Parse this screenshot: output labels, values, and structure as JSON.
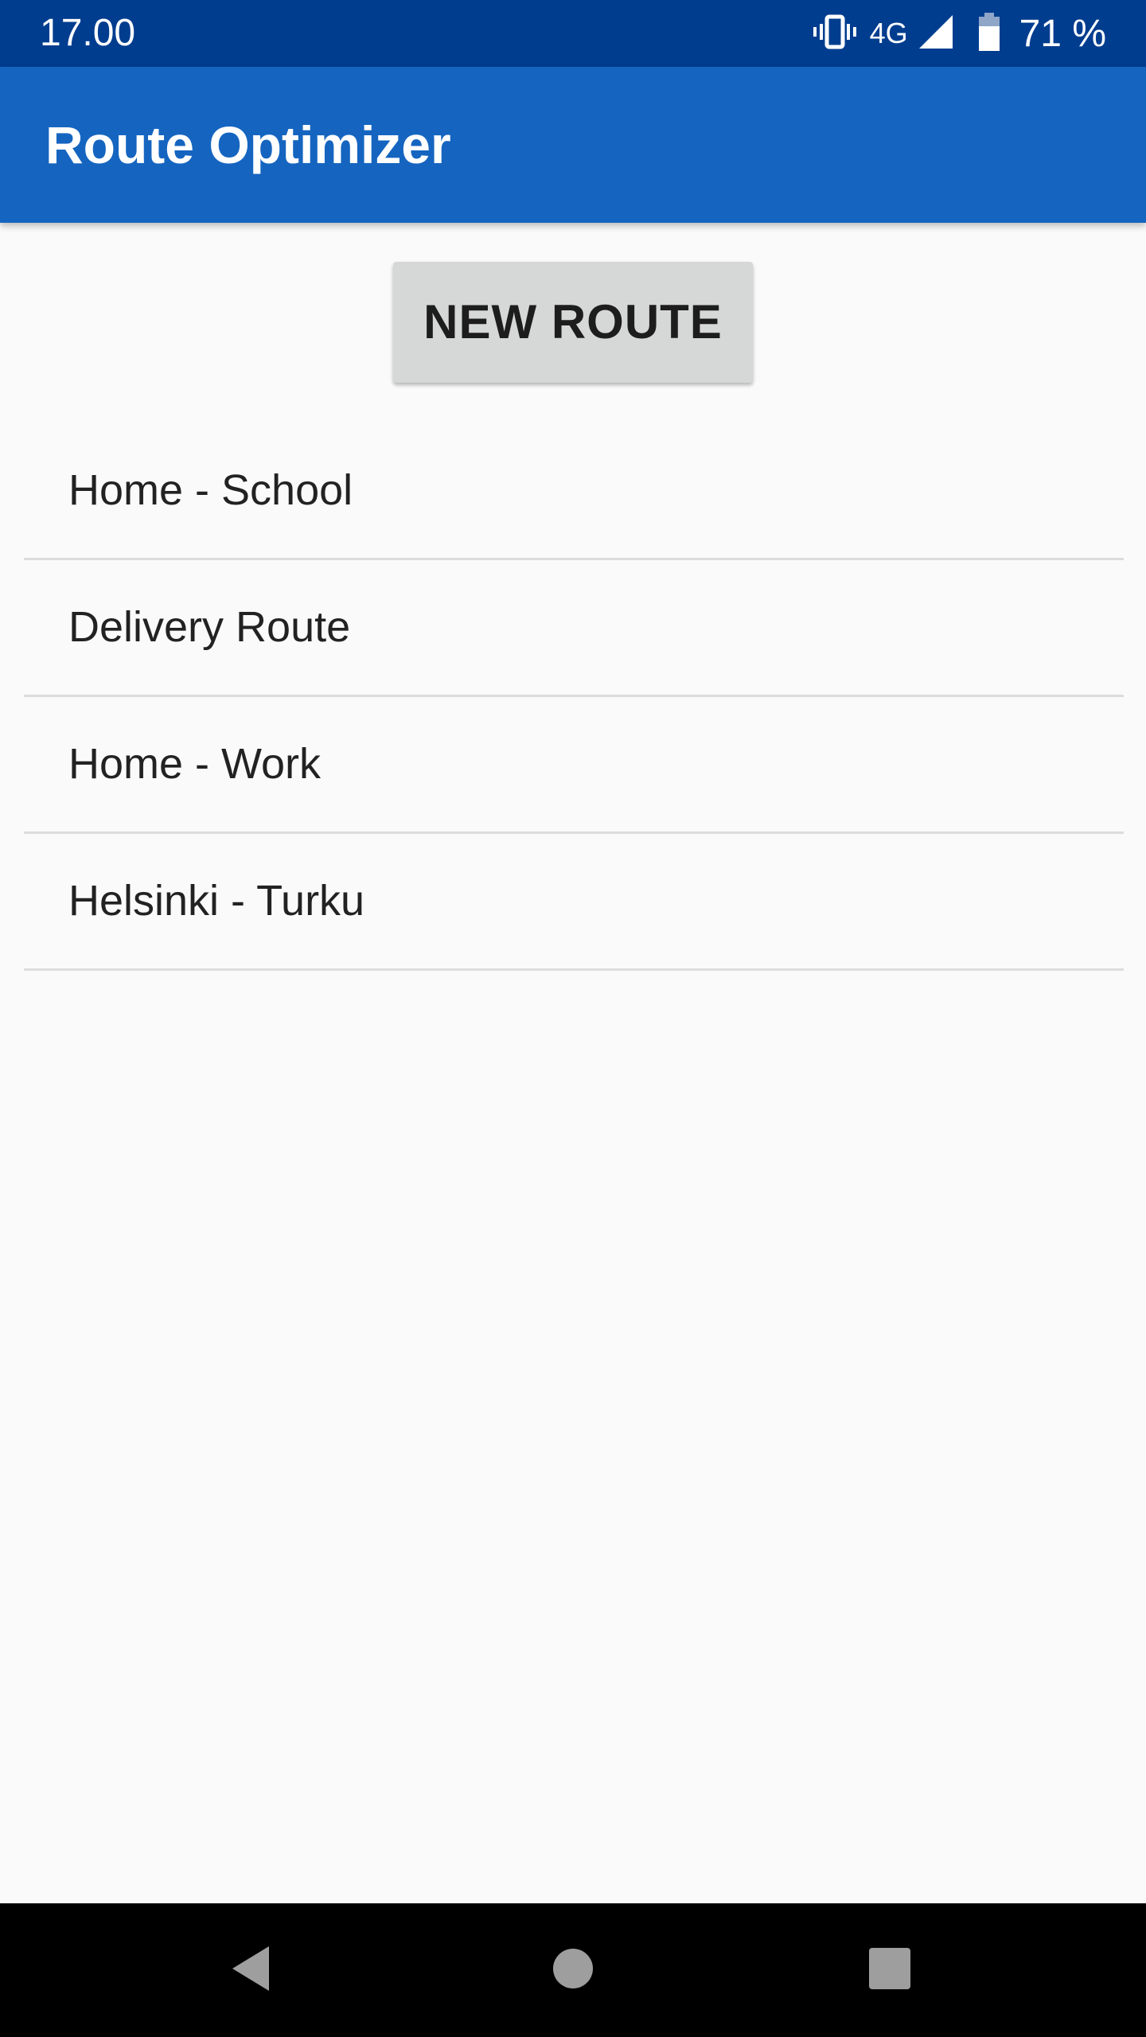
{
  "status_bar": {
    "time": "17.00",
    "network": "4G",
    "battery": "71 %",
    "icons": [
      "vibrate-icon",
      "signal-icon",
      "battery-icon"
    ]
  },
  "app_bar": {
    "title": "Route Optimizer"
  },
  "new_route_button": {
    "label": "NEW ROUTE"
  },
  "routes": [
    {
      "name": "Home - School"
    },
    {
      "name": "Delivery Route"
    },
    {
      "name": "Home - Work"
    },
    {
      "name": "Helsinki - Turku"
    }
  ],
  "nav_bar": {
    "buttons": [
      "back-icon",
      "home-icon",
      "recents-icon"
    ]
  },
  "colors": {
    "status_bar": "#003d8f",
    "app_bar": "#1565c0",
    "background": "#fafafa",
    "button": "#d6d7d7",
    "divider": "#dcdcdc",
    "nav_bar": "#000000"
  }
}
